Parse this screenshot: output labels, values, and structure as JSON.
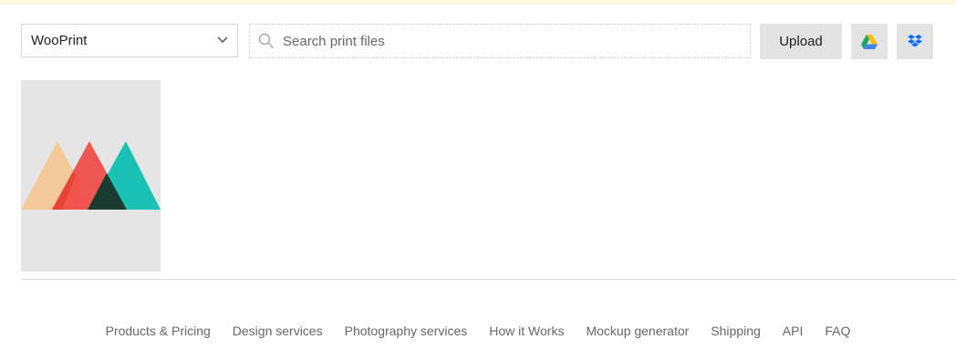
{
  "toolbar": {
    "store_select": {
      "value": "WooPrint"
    },
    "search": {
      "placeholder": "Search print files",
      "value": ""
    },
    "upload_label": "Upload",
    "gdrive_icon": "google-drive-icon",
    "dropbox_icon": "dropbox-icon"
  },
  "files": [
    {
      "icon": "mountain-logo-thumbnail",
      "colors": [
        "#f4c99a",
        "#ef4a45",
        "#19c2b4",
        "#1a3c30"
      ]
    }
  ],
  "footer": {
    "links": [
      "Products & Pricing",
      "Design services",
      "Photography services",
      "How it Works",
      "Mockup generator",
      "Shipping",
      "API",
      "FAQ"
    ]
  }
}
